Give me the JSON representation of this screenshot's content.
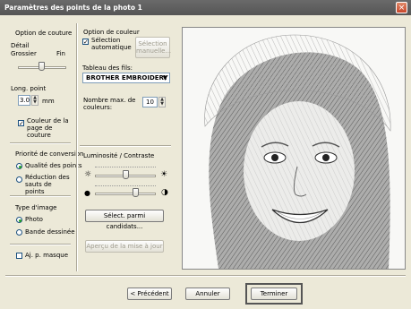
{
  "window": {
    "title": "Paramètres des points de la photo 1"
  },
  "stitch_option": {
    "header": "Option de couture",
    "detail_label": "Détail",
    "coarse_label": "Grossier",
    "fine_label": "Fin",
    "detail_level": 0.5,
    "stitch_length_label": "Long. point",
    "stitch_length_value": "3.0",
    "stitch_length_unit": "mm",
    "fabric_color_label": "Couleur de la page de couture",
    "fabric_color_checked": true
  },
  "conversion_priority": {
    "header": "Priorité de conversion",
    "options": [
      "Qualité des points",
      "Réduction des sauts de points"
    ],
    "selected": 0
  },
  "image_type": {
    "header": "Type d'image",
    "options": [
      "Photo",
      "Bande dessinée"
    ],
    "selected": 0
  },
  "mask_adjust": {
    "label": "Aj. p. masque",
    "checked": false
  },
  "color_option": {
    "header": "Option de couleur",
    "auto_select_label": "Sélection automatique",
    "auto_select_checked": true,
    "manual_select_label": "Sélection manuelle...",
    "thread_table_label": "Tableau des fils:",
    "thread_table_value": "BROTHER EMBROIDERY",
    "max_colors_label": "Nombre max. de couleurs:",
    "max_colors_value": "10"
  },
  "brightness_contrast": {
    "header": "Luminosité / Contraste",
    "brightness": 0.5,
    "contrast": 0.6,
    "select_candidates_button": "Sélect. parmi candidats...",
    "refresh_preview_button": "Aperçu de la mise à jour"
  },
  "footer": {
    "previous_button": "< Précédent",
    "cancel_button": "Annuler",
    "finish_button": "Terminer"
  },
  "icons": {
    "brightness_low": "☼",
    "brightness_high": "☀",
    "contrast_low": "●",
    "contrast_high": "◑"
  }
}
